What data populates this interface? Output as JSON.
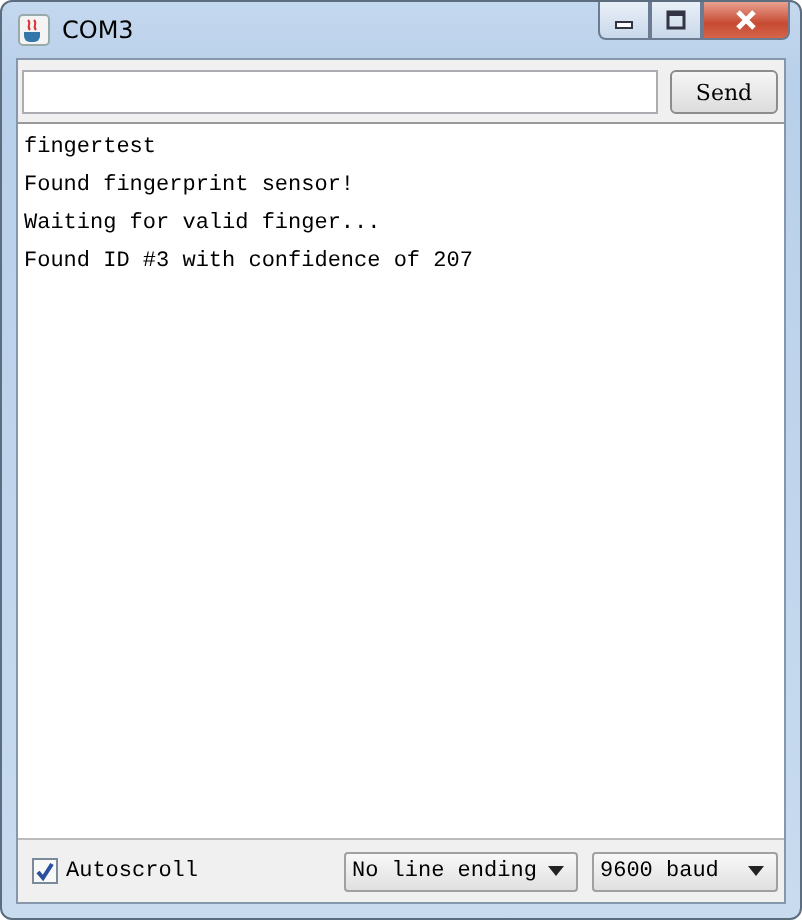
{
  "window": {
    "title": "COM3"
  },
  "send_button": "Send",
  "output_lines": [
    "fingertest",
    "Found fingerprint sensor!",
    "Waiting for valid finger...",
    "Found ID #3 with confidence of 207"
  ],
  "autoscroll": {
    "label": "Autoscroll",
    "checked": true
  },
  "line_ending": {
    "value": "No line ending"
  },
  "baud": {
    "value": "9600 baud"
  }
}
